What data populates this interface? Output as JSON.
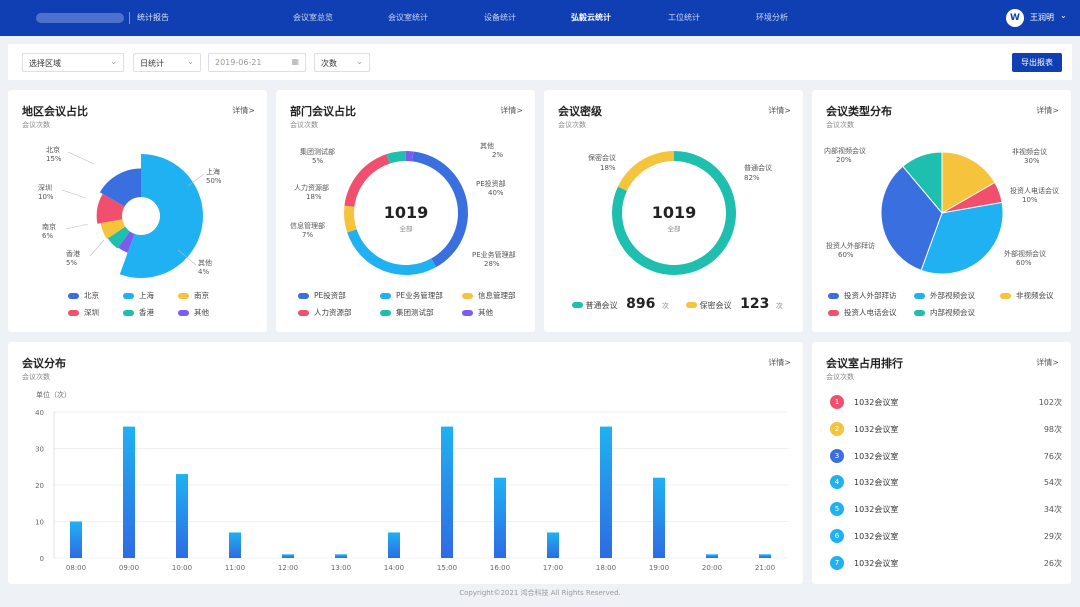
{
  "nav": {
    "brand_title": "统计报告",
    "items": [
      "会议室总览",
      "会议室统计",
      "设备统计",
      "弘毅云统计",
      "工位统计",
      "环境分析"
    ],
    "active_index": 3,
    "user_initial": "W",
    "user_name": "王润明"
  },
  "filters": {
    "region": "选择区域",
    "period": "日统计",
    "date": "2019-06-21",
    "metric": "次数",
    "export_label": "导出报表"
  },
  "cards": {
    "region": {
      "title": "地区会议占比",
      "sub": "会议次数",
      "link": "详情>",
      "labels": [
        {
          "name": "北京",
          "pct": "15%"
        },
        {
          "name": "上海",
          "pct": "50%"
        },
        {
          "name": "深圳",
          "pct": "10%"
        },
        {
          "name": "南京",
          "pct": "6%"
        },
        {
          "name": "香港",
          "pct": "5%"
        },
        {
          "name": "其他",
          "pct": "4%"
        }
      ],
      "legend": [
        "北京",
        "上海",
        "南京",
        "深圳",
        "香港",
        "其他"
      ]
    },
    "dept": {
      "title": "部门会议占比",
      "sub": "会议次数",
      "link": "详情>",
      "center_value": "1019",
      "center_label": "全部",
      "labels": [
        {
          "name": "其他",
          "pct": "2%"
        },
        {
          "name": "PE投资部",
          "pct": "40%"
        },
        {
          "name": "PE业务管理部",
          "pct": "28%"
        },
        {
          "name": "信息管理部",
          "pct": "7%"
        },
        {
          "name": "人力资源部",
          "pct": "18%"
        },
        {
          "name": "集团测试部",
          "pct": "5%"
        }
      ],
      "legend": [
        "PE投资部",
        "PE业务管理部",
        "信息管理部",
        "人力资源部",
        "集团测试部",
        "其他"
      ]
    },
    "secret": {
      "title": "会议密级",
      "sub": "会议次数",
      "link": "详情>",
      "center_value": "1019",
      "center_label": "全部",
      "labels": [
        {
          "name": "保密会议",
          "pct": "18%"
        },
        {
          "name": "普通会议",
          "pct": "82%"
        }
      ],
      "counts": [
        {
          "name": "普通会议",
          "value": "896",
          "unit": "次"
        },
        {
          "name": "保密会议",
          "value": "123",
          "unit": "次"
        }
      ]
    },
    "type": {
      "title": "会议类型分布",
      "sub": "会议次数",
      "link": "详情>",
      "labels": [
        {
          "name": "非视频会议",
          "pct": "30%"
        },
        {
          "name": "投资人电话会议",
          "pct": "10%"
        },
        {
          "name": "外部视频会议",
          "pct": "60%"
        },
        {
          "name": "投资人外部拜访",
          "pct": "60%"
        },
        {
          "name": "内部视频会议",
          "pct": "20%"
        }
      ],
      "legend": [
        "投资人外部拜访",
        "外部视频会议",
        "非视频会议",
        "投资人电话会议",
        "内部视频会议"
      ]
    },
    "distribution": {
      "title": "会议分布",
      "sub": "会议次数",
      "link": "详情>"
    },
    "ranking": {
      "title": "会议室占用排行",
      "sub": "会议次数",
      "link": "详情>",
      "rows": [
        {
          "rank": "1",
          "name": "1032会议室",
          "value": "102次"
        },
        {
          "rank": "2",
          "name": "1032会议室",
          "value": "98次"
        },
        {
          "rank": "3",
          "name": "1032会议室",
          "value": "76次"
        },
        {
          "rank": "4",
          "name": "1032会议室",
          "value": "54次"
        },
        {
          "rank": "5",
          "name": "1032会议室",
          "value": "34次"
        },
        {
          "rank": "6",
          "name": "1032会议室",
          "value": "29次"
        },
        {
          "rank": "7",
          "name": "1032会议室",
          "value": "26次"
        }
      ]
    }
  },
  "colors": {
    "nav_bg": "#0f3fb2",
    "blue": "#3a6fe0",
    "cyan": "#1fb1f2",
    "yellow": "#f5c33c",
    "red": "#f0506e",
    "teal": "#1fbfb0",
    "purple": "#7b5cf0",
    "rank_red": "#f0506e",
    "rank_yellow": "#f5c33c",
    "rank_blue": "#3a6fe0"
  },
  "chart_data": [
    {
      "type": "pie",
      "title": "地区会议占比",
      "style": "rose",
      "labels": [
        "北京",
        "上海",
        "深圳",
        "南京",
        "香港",
        "其他"
      ],
      "values": [
        15,
        50,
        10,
        6,
        5,
        4
      ]
    },
    {
      "type": "pie",
      "title": "部门会议占比",
      "style": "donut",
      "labels": [
        "PE投资部",
        "PE业务管理部",
        "信息管理部",
        "人力资源部",
        "集团测试部",
        "其他"
      ],
      "values": [
        40,
        28,
        7,
        18,
        5,
        2
      ]
    },
    {
      "type": "pie",
      "title": "会议密级",
      "style": "donut",
      "labels": [
        "普通会议",
        "保密会议"
      ],
      "values": [
        82,
        18
      ]
    },
    {
      "type": "pie",
      "title": "会议类型分布",
      "labels": [
        "非视频会议",
        "投资人电话会议",
        "外部视频会议",
        "投资人外部拜访",
        "内部视频会议"
      ],
      "values": [
        30,
        10,
        60,
        60,
        20
      ]
    },
    {
      "type": "bar",
      "title": "会议分布",
      "ylabel": "单位（次）",
      "ylim": [
        0,
        40
      ],
      "yticks": [
        0,
        10,
        20,
        30,
        40
      ],
      "categories": [
        "08:00",
        "09:00",
        "10:00",
        "11:00",
        "12:00",
        "13:00",
        "14:00",
        "15:00",
        "16:00",
        "17:00",
        "18:00",
        "19:00",
        "20:00",
        "21:00"
      ],
      "series": [
        {
          "values": [
            10,
            36,
            23,
            7,
            1,
            1,
            7,
            36,
            22,
            7,
            36,
            22,
            1,
            1
          ]
        }
      ],
      "grid": true
    }
  ],
  "footer": "Copyright©2021 鸿合科技 All Rights Reserved."
}
